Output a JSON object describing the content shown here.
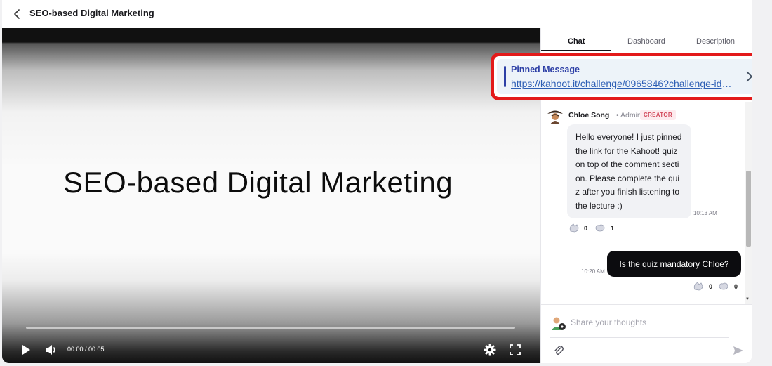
{
  "header": {
    "title": "SEO-based Digital Marketing"
  },
  "video": {
    "slide_title": "SEO-based Digital Marketing",
    "time": "00:00 / 00:05",
    "progress": 0.0
  },
  "panel": {
    "tabs": [
      {
        "label": "Chat",
        "active": true
      },
      {
        "label": "Dashboard",
        "active": false
      },
      {
        "label": "Description",
        "active": false
      }
    ],
    "pinned": {
      "label": "Pinned Message",
      "link": "https://kahoot.it/challenge/0965846?challenge-id=..."
    },
    "messages": [
      {
        "author": "Chloe Song",
        "role": "• Admin",
        "badge": "CREATOR",
        "text": "Hello everyone! I just pinned the link for the Kahoot! quiz on top of the comment section. Please complete the quiz after you finish listening to the lecture :)",
        "time": "10:13 AM",
        "reactions": [
          {
            "icon": "clap-icon",
            "count": "0"
          },
          {
            "icon": "heart-hands-icon",
            "count": "1"
          }
        ]
      },
      {
        "text": "Is the quiz mandatory Chloe?",
        "time": "10:20 AM",
        "reactions": [
          {
            "icon": "clap-icon",
            "count": "0"
          },
          {
            "icon": "heart-hands-icon",
            "count": "0"
          }
        ]
      }
    ],
    "composer": {
      "placeholder": "Share your thoughts"
    }
  },
  "colors": {
    "highlight": "#e31a1a",
    "pin_accent": "#2d3fa6",
    "link": "#2e5fb5"
  }
}
